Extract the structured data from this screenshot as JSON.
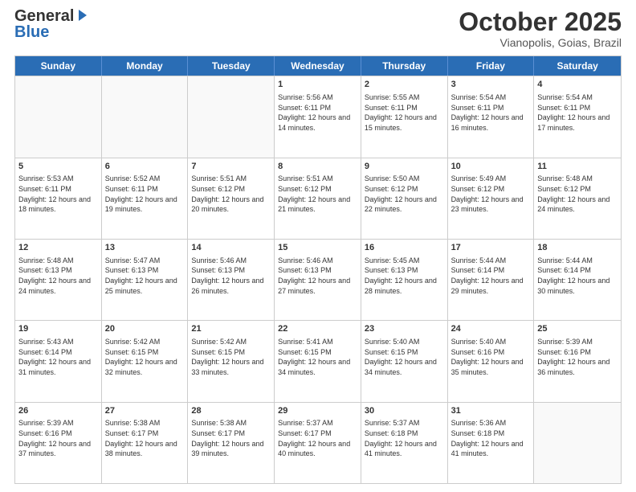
{
  "header": {
    "logo_general": "General",
    "logo_blue": "Blue",
    "title": "October 2025",
    "location": "Vianopolis, Goias, Brazil"
  },
  "weekdays": [
    "Sunday",
    "Monday",
    "Tuesday",
    "Wednesday",
    "Thursday",
    "Friday",
    "Saturday"
  ],
  "weeks": [
    [
      {
        "day": "",
        "info": ""
      },
      {
        "day": "",
        "info": ""
      },
      {
        "day": "",
        "info": ""
      },
      {
        "day": "1",
        "info": "Sunrise: 5:56 AM\nSunset: 6:11 PM\nDaylight: 12 hours and 14 minutes."
      },
      {
        "day": "2",
        "info": "Sunrise: 5:55 AM\nSunset: 6:11 PM\nDaylight: 12 hours and 15 minutes."
      },
      {
        "day": "3",
        "info": "Sunrise: 5:54 AM\nSunset: 6:11 PM\nDaylight: 12 hours and 16 minutes."
      },
      {
        "day": "4",
        "info": "Sunrise: 5:54 AM\nSunset: 6:11 PM\nDaylight: 12 hours and 17 minutes."
      }
    ],
    [
      {
        "day": "5",
        "info": "Sunrise: 5:53 AM\nSunset: 6:11 PM\nDaylight: 12 hours and 18 minutes."
      },
      {
        "day": "6",
        "info": "Sunrise: 5:52 AM\nSunset: 6:11 PM\nDaylight: 12 hours and 19 minutes."
      },
      {
        "day": "7",
        "info": "Sunrise: 5:51 AM\nSunset: 6:12 PM\nDaylight: 12 hours and 20 minutes."
      },
      {
        "day": "8",
        "info": "Sunrise: 5:51 AM\nSunset: 6:12 PM\nDaylight: 12 hours and 21 minutes."
      },
      {
        "day": "9",
        "info": "Sunrise: 5:50 AM\nSunset: 6:12 PM\nDaylight: 12 hours and 22 minutes."
      },
      {
        "day": "10",
        "info": "Sunrise: 5:49 AM\nSunset: 6:12 PM\nDaylight: 12 hours and 23 minutes."
      },
      {
        "day": "11",
        "info": "Sunrise: 5:48 AM\nSunset: 6:12 PM\nDaylight: 12 hours and 24 minutes."
      }
    ],
    [
      {
        "day": "12",
        "info": "Sunrise: 5:48 AM\nSunset: 6:13 PM\nDaylight: 12 hours and 24 minutes."
      },
      {
        "day": "13",
        "info": "Sunrise: 5:47 AM\nSunset: 6:13 PM\nDaylight: 12 hours and 25 minutes."
      },
      {
        "day": "14",
        "info": "Sunrise: 5:46 AM\nSunset: 6:13 PM\nDaylight: 12 hours and 26 minutes."
      },
      {
        "day": "15",
        "info": "Sunrise: 5:46 AM\nSunset: 6:13 PM\nDaylight: 12 hours and 27 minutes."
      },
      {
        "day": "16",
        "info": "Sunrise: 5:45 AM\nSunset: 6:13 PM\nDaylight: 12 hours and 28 minutes."
      },
      {
        "day": "17",
        "info": "Sunrise: 5:44 AM\nSunset: 6:14 PM\nDaylight: 12 hours and 29 minutes."
      },
      {
        "day": "18",
        "info": "Sunrise: 5:44 AM\nSunset: 6:14 PM\nDaylight: 12 hours and 30 minutes."
      }
    ],
    [
      {
        "day": "19",
        "info": "Sunrise: 5:43 AM\nSunset: 6:14 PM\nDaylight: 12 hours and 31 minutes."
      },
      {
        "day": "20",
        "info": "Sunrise: 5:42 AM\nSunset: 6:15 PM\nDaylight: 12 hours and 32 minutes."
      },
      {
        "day": "21",
        "info": "Sunrise: 5:42 AM\nSunset: 6:15 PM\nDaylight: 12 hours and 33 minutes."
      },
      {
        "day": "22",
        "info": "Sunrise: 5:41 AM\nSunset: 6:15 PM\nDaylight: 12 hours and 34 minutes."
      },
      {
        "day": "23",
        "info": "Sunrise: 5:40 AM\nSunset: 6:15 PM\nDaylight: 12 hours and 34 minutes."
      },
      {
        "day": "24",
        "info": "Sunrise: 5:40 AM\nSunset: 6:16 PM\nDaylight: 12 hours and 35 minutes."
      },
      {
        "day": "25",
        "info": "Sunrise: 5:39 AM\nSunset: 6:16 PM\nDaylight: 12 hours and 36 minutes."
      }
    ],
    [
      {
        "day": "26",
        "info": "Sunrise: 5:39 AM\nSunset: 6:16 PM\nDaylight: 12 hours and 37 minutes."
      },
      {
        "day": "27",
        "info": "Sunrise: 5:38 AM\nSunset: 6:17 PM\nDaylight: 12 hours and 38 minutes."
      },
      {
        "day": "28",
        "info": "Sunrise: 5:38 AM\nSunset: 6:17 PM\nDaylight: 12 hours and 39 minutes."
      },
      {
        "day": "29",
        "info": "Sunrise: 5:37 AM\nSunset: 6:17 PM\nDaylight: 12 hours and 40 minutes."
      },
      {
        "day": "30",
        "info": "Sunrise: 5:37 AM\nSunset: 6:18 PM\nDaylight: 12 hours and 41 minutes."
      },
      {
        "day": "31",
        "info": "Sunrise: 5:36 AM\nSunset: 6:18 PM\nDaylight: 12 hours and 41 minutes."
      },
      {
        "day": "",
        "info": ""
      }
    ]
  ]
}
